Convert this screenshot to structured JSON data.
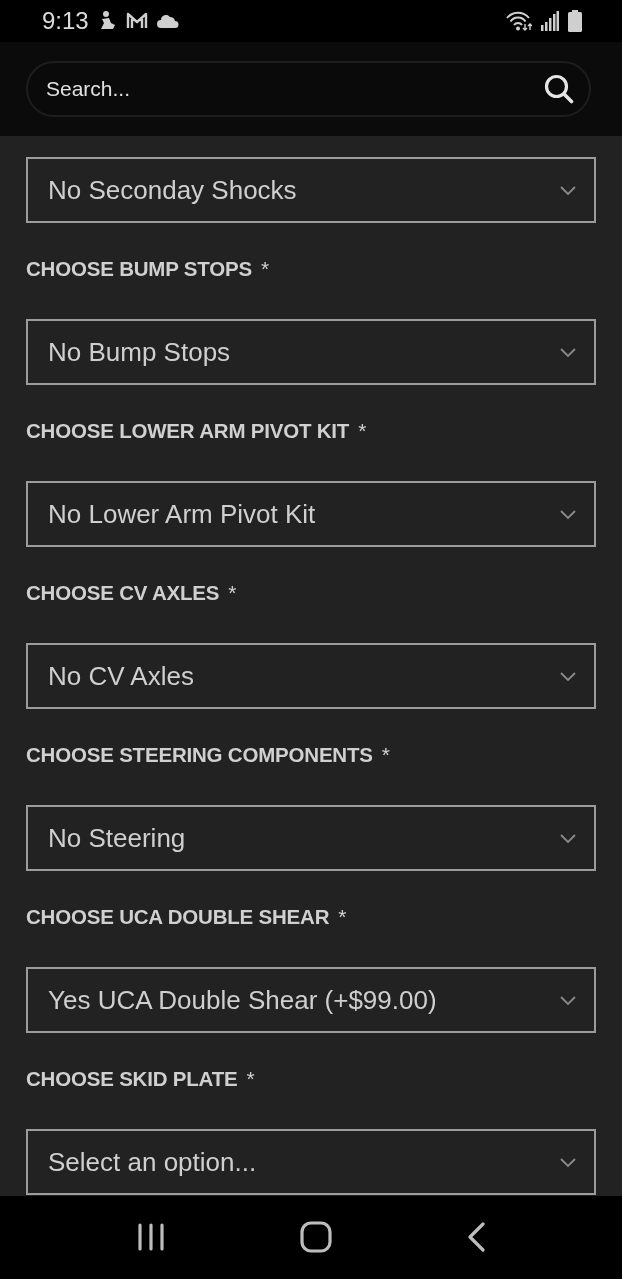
{
  "status_bar": {
    "time": "9:13"
  },
  "search": {
    "placeholder": "Search..."
  },
  "fields": [
    {
      "value": "No Seconday Shocks"
    },
    {
      "label": "CHOOSE BUMP STOPS",
      "required_mark": "*",
      "value": "No Bump Stops"
    },
    {
      "label": "CHOOSE LOWER ARM PIVOT KIT",
      "required_mark": "*",
      "value": "No Lower Arm Pivot Kit"
    },
    {
      "label": "CHOOSE CV AXLES",
      "required_mark": "*",
      "value": "No CV Axles"
    },
    {
      "label": "CHOOSE STEERING COMPONENTS",
      "required_mark": "*",
      "value": "No Steering"
    },
    {
      "label": "CHOOSE UCA DOUBLE SHEAR",
      "required_mark": "*",
      "value": "Yes UCA Double Shear (+$99.00)"
    },
    {
      "label": "CHOOSE SKID PLATE",
      "required_mark": "*",
      "value": "Select an option..."
    }
  ]
}
